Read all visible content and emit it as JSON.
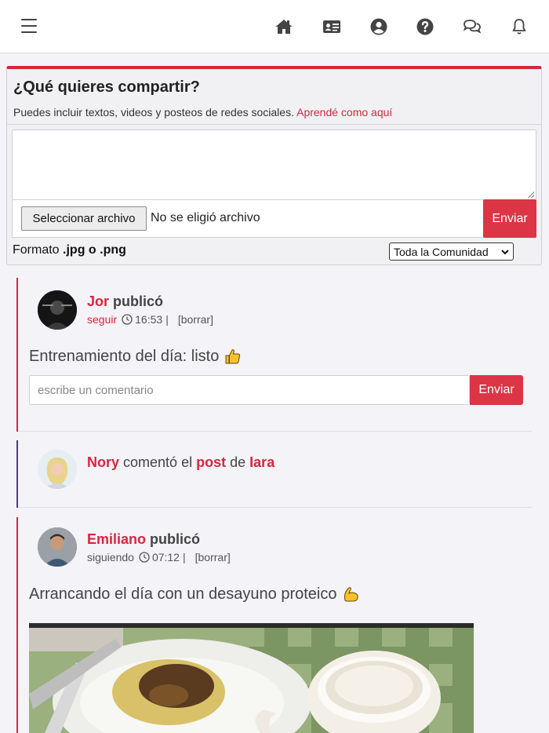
{
  "nav": {
    "icons": [
      "menu-icon",
      "home-icon",
      "id-card-icon",
      "user-circle-icon",
      "help-icon",
      "chat-icon",
      "bell-icon"
    ]
  },
  "composer": {
    "title": "¿Qué quieres compartir?",
    "subtitle": "Puedes incluir textos, videos y posteos de redes sociales.",
    "help_link": "Aprendé como aquí",
    "text_value": "",
    "file_button": "Seleccionar archivo",
    "file_status": "No se eligió archivo",
    "send_label": "Enviar",
    "format_prefix": "Formato",
    "format_value": ".jpg o .png",
    "audience_selected": "Toda la Comunidad"
  },
  "feed": {
    "posts": [
      {
        "author": "Jor",
        "verb": "publicó",
        "follow": "seguir",
        "time": "16:53",
        "separator": "|",
        "delete": "[borrar]",
        "text": "Entrenamiento del día: listo",
        "emoji": "thumbs-up-icon",
        "comment_placeholder": "escribe un comentario",
        "comment_send": "Enviar"
      },
      {
        "actor": "Nory",
        "verb": "comentó el",
        "object": "post",
        "preposition": "de",
        "target": "Iara"
      },
      {
        "author": "Emiliano",
        "verb": "publicó",
        "follow": "siguiendo",
        "time": "07:12",
        "separator": "|",
        "delete": "[borrar]",
        "text": "Arrancando el día con un desayuno proteico",
        "emoji": "flexed-biceps-icon"
      }
    ]
  },
  "colors": {
    "accent": "#dc3545",
    "activity_border": "#4a3a8c"
  }
}
